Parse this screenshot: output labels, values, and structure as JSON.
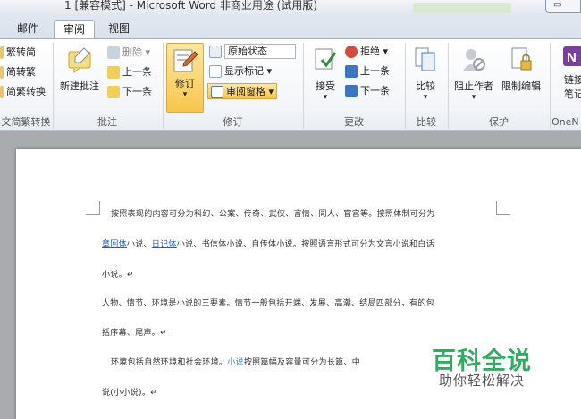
{
  "window": {
    "title": "1 [兼容模式] - Microsoft Word 非商业用途 (试用版)",
    "btn": "▭"
  },
  "tabs": [
    {
      "label": "邮件"
    },
    {
      "label": "审阅"
    },
    {
      "label": "视图"
    }
  ],
  "ribbon": {
    "chinese_convert": {
      "items": [
        "繁转简",
        "简转繁",
        "简繁转换"
      ],
      "label": "文简繁转换"
    },
    "comments": {
      "new_comment": "新建批注",
      "delete": "删除",
      "previous": "上一条",
      "next": "下一条",
      "label": "批注"
    },
    "tracking": {
      "track_changes": "修订",
      "display_mode": "原始状态",
      "show_markup": "显示标记",
      "review_pane": "审阅窗格",
      "label": "修订"
    },
    "changes": {
      "accept": "接受",
      "reject": "拒绝",
      "previous": "上一条",
      "next": "下一条",
      "label": "更改"
    },
    "compare": {
      "compare": "比较",
      "label": "比较"
    },
    "protect": {
      "block_authors": "阻止作者",
      "restrict_editing": "限制编辑",
      "label": "保护"
    },
    "onenote": {
      "line1": "链接",
      "line2": "笔记",
      "label": "OneN"
    }
  },
  "document": {
    "paragraphs": [
      {
        "segments": [
          {
            "text": "按照表现的内容可分为科幻、公案、传奇、武侠、言情、同人、官宫等。按照体制可分为",
            "style": ""
          }
        ]
      },
      {
        "segments": [
          {
            "text": "章回体",
            "style": "link"
          },
          {
            "text": "小说、",
            "style": ""
          },
          {
            "text": "日记体",
            "style": "link"
          },
          {
            "text": "小说、书信体小说、自传体小说。按照语言形式可分为文言小说和白话",
            "style": ""
          }
        ]
      },
      {
        "segments": [
          {
            "text": "小说。↵",
            "style": ""
          }
        ]
      },
      {
        "segments": [
          {
            "text": "人物、情节、环境是小说的三要素。情节一般包括开端、发展、高潮、结局四部分，有的包",
            "style": ""
          }
        ]
      },
      {
        "segments": [
          {
            "text": "括序幕、尾声。↵",
            "style": ""
          }
        ]
      },
      {
        "segments": [
          {
            "text": "环境包括自然环境和社会环境。",
            "style": ""
          },
          {
            "text": "小说",
            "style": "blue"
          },
          {
            "text": "按照篇幅及容量可分为长篇、中",
            "style": ""
          }
        ]
      },
      {
        "segments": [
          {
            "text": "说(小小说)。↵",
            "style": ""
          }
        ]
      }
    ]
  },
  "watermark": {
    "title": "百科全说",
    "subtitle": "助你轻松解决"
  }
}
